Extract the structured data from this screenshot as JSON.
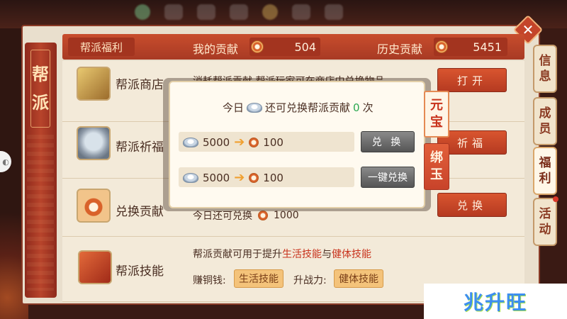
{
  "guild_tab": {
    "label_1": "帮",
    "label_2": "派"
  },
  "header": {
    "title": "帮派福利",
    "my_contribution_label": "我的贡献",
    "my_contribution_value": "504",
    "history_contribution_label": "历史贡献",
    "history_contribution_value": "5451"
  },
  "rows": [
    {
      "title": "帮派商店",
      "desc": "消耗帮派贡献,帮派玩家可在商店中兑换物品",
      "button": "打开",
      "icon": "guild-shop-icon"
    },
    {
      "title": "帮派祈福",
      "button": "祈福",
      "icon": "blessing-mask-icon"
    },
    {
      "title": "兑换贡献",
      "desc_prefix": "今日还可兑换",
      "desc_value": "1000",
      "button": "兑换",
      "icon": "contribution-ring-icon"
    },
    {
      "title": "帮派技能",
      "desc_1": "帮派贡献可用于提升",
      "desc_hl_1": "生活技能",
      "desc_2": "与",
      "desc_hl_2": "健体技能",
      "earn_label": "赚铜钱:",
      "earn_button": "生活技能",
      "power_label": "升战力:",
      "power_button": "健体技能",
      "icon": "guild-skill-icon"
    }
  ],
  "right_tabs": [
    {
      "label": "信息"
    },
    {
      "label": "成员"
    },
    {
      "label": "福利"
    },
    {
      "label": "活动"
    }
  ],
  "modal": {
    "line_prefix": "今日",
    "line_mid": "还可兑换帮派贡献",
    "line_count": "0",
    "line_suffix": "次",
    "row1_cost": "5000",
    "row1_gain": "100",
    "row1_button": "兑 换",
    "row2_cost": "5000",
    "row2_gain": "100",
    "row2_button": "一键兑换",
    "tab_on": "元宝",
    "tab_off": "绑玉"
  },
  "watermark": "兆升旺",
  "colors": {
    "accent_red": "#c8432a",
    "panel_bg": "#e9dfcd",
    "highlight_red": "#c8321c",
    "count_green": "#2aa850"
  }
}
